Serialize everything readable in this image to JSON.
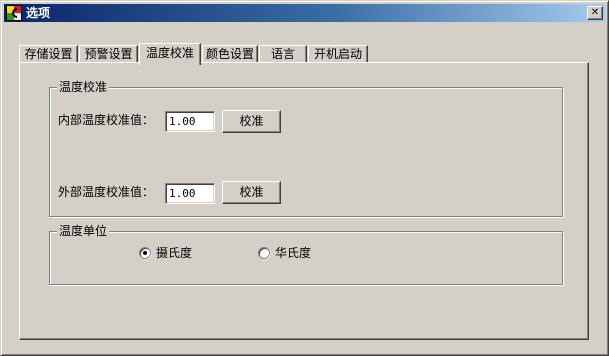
{
  "window": {
    "title": "选项",
    "close_glyph": "✕",
    "icon": "app-icon"
  },
  "tabs": [
    {
      "label": "存储设置",
      "active": false
    },
    {
      "label": "预警设置",
      "active": false
    },
    {
      "label": "温度校准",
      "active": true
    },
    {
      "label": "颜色设置",
      "active": false
    },
    {
      "label": "语言",
      "active": false
    },
    {
      "label": "开机启动",
      "active": false
    }
  ],
  "calibration_group": {
    "title": "温度校准",
    "internal": {
      "label": "内部温度校准值：",
      "value": "1.00",
      "button": "校准"
    },
    "external": {
      "label": "外部温度校准值：",
      "value": "1.00",
      "button": "校准"
    }
  },
  "unit_group": {
    "title": "温度单位",
    "options": [
      {
        "label": "摄氏度",
        "selected": true
      },
      {
        "label": "华氏度",
        "selected": false
      }
    ]
  }
}
